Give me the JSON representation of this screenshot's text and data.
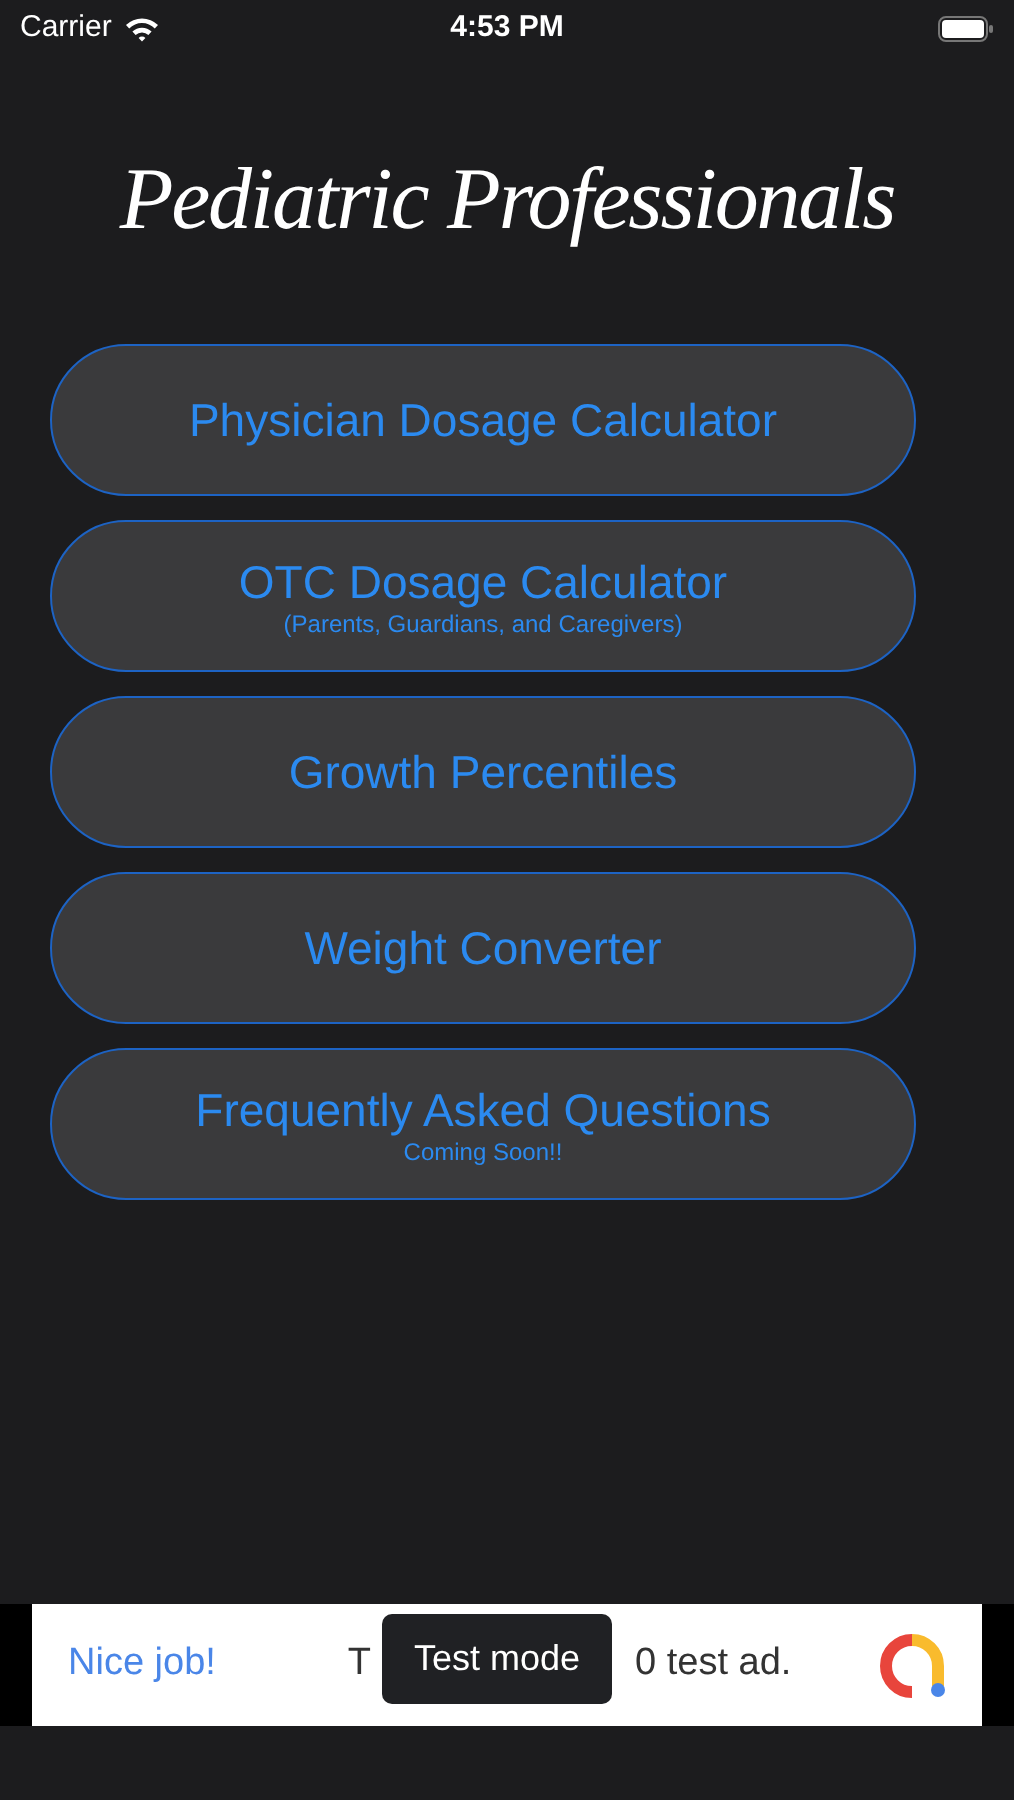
{
  "status_bar": {
    "carrier": "Carrier",
    "time": "4:53 PM"
  },
  "title": "Pediatric Professionals",
  "menu": [
    {
      "label": "Physician Dosage Calculator"
    },
    {
      "label": "OTC Dosage Calculator",
      "sublabel": "(Parents, Guardians, and Caregivers)"
    },
    {
      "label": "Growth Percentiles"
    },
    {
      "label": "Weight Converter"
    },
    {
      "label": "Frequently Asked Questions",
      "sublabel": "Coming Soon!!"
    }
  ],
  "ad": {
    "headline": "Nice job!",
    "text_start": "T",
    "text_end": "0 test ad.",
    "tooltip": "Test mode"
  }
}
